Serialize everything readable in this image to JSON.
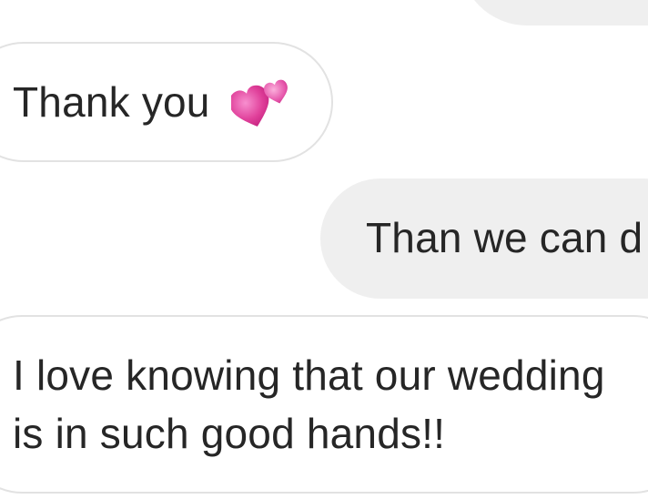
{
  "messages": [
    {
      "side": "sent",
      "text": ""
    },
    {
      "side": "received",
      "text": "Thank you",
      "emoji": "two-hearts-icon"
    },
    {
      "side": "sent",
      "text": "Than we can d"
    },
    {
      "side": "received",
      "line1": "I love knowing that our wedding",
      "line2": "is in such good hands!!"
    }
  ],
  "colors": {
    "sent_bubble": "#efefef",
    "received_border": "#e2e2e2",
    "text": "#262626",
    "heart": "#e0409a"
  }
}
